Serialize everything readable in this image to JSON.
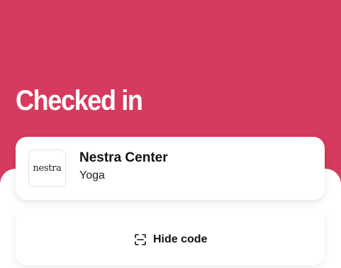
{
  "header": {
    "title": "Checked in"
  },
  "venue": {
    "logo_text": "nestra",
    "name": "Nestra Center",
    "type": "Yoga"
  },
  "code": {
    "toggle_label": "Hide code",
    "icon": "scan-icon"
  },
  "colors": {
    "hero_background": "#d63a5e",
    "card_background": "#ffffff",
    "text_primary": "#111111"
  }
}
